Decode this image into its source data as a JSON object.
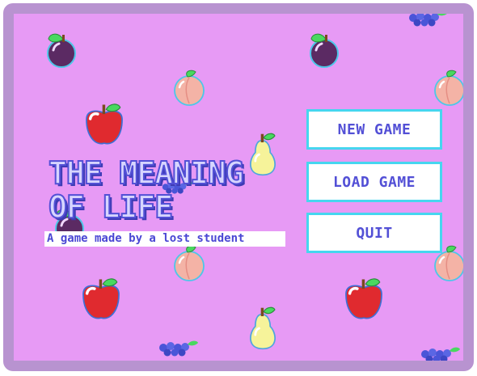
{
  "game": {
    "title_line1": "THE MEANING",
    "title_line2": "OF LIFE",
    "subtitle": "A game made by a lost student"
  },
  "menu": {
    "items": [
      {
        "label": "NEW GAME"
      },
      {
        "label": "LOAD GAME"
      },
      {
        "label": "QUIT"
      }
    ]
  },
  "colors": {
    "background": "#e79af5",
    "frame": "#b893d0",
    "title_fill": "#d7d5ff",
    "title_outline": "#5350d6",
    "button_border": "#46d6ef",
    "button_text": "#5350d6"
  },
  "decorations": [
    "plum-icon",
    "peach-icon",
    "apple-icon",
    "pear-icon",
    "blueberries-icon"
  ]
}
